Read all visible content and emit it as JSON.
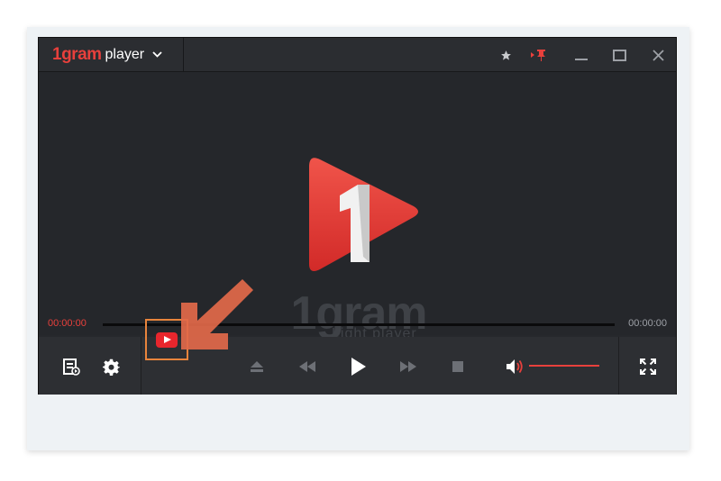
{
  "app": {
    "brand": "1gram",
    "name": "player",
    "watermark_brand": "1gram",
    "watermark_tagline": "Light player"
  },
  "titlebar": {
    "icons": [
      "chevron-down-icon",
      "star-icon",
      "pin-icon",
      "minimize-icon",
      "maximize-icon",
      "close-icon"
    ]
  },
  "playback": {
    "current_time": "00:00:00",
    "total_time": "00:00:00",
    "progress": 0,
    "volume": 1.0
  },
  "controls": {
    "icons": [
      "playlist-icon",
      "settings-icon",
      "youtube-icon",
      "eject-icon",
      "rewind-icon",
      "play-icon",
      "fast-forward-icon",
      "stop-icon",
      "volume-icon",
      "fullscreen-icon"
    ]
  },
  "colors": {
    "accent": "#e8403c",
    "highlight": "#e8843c",
    "youtube": "#e8262d",
    "window_bg": "#26282c",
    "icon": "#9da0a6"
  }
}
